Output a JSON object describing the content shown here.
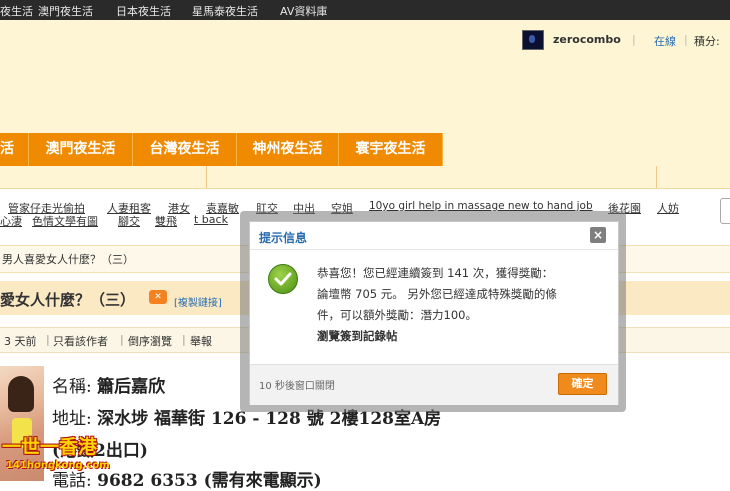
{
  "topnav": [
    "夜生活",
    "澳門夜生活",
    "日本夜生活",
    "星馬泰夜生活",
    "AV資料庫"
  ],
  "user": {
    "name": "zerocombo",
    "status": "在線",
    "credits_label": "積分:"
  },
  "main_nav": [
    "活",
    "澳門夜生活",
    "台灣夜生活",
    "神州夜生活",
    "寰宇夜生活"
  ],
  "tags_row1": [
    "管家仔走光偷拍",
    "人妻租客",
    "港女",
    "袁嘉敏",
    "肛交",
    "中出",
    "空姐",
    "10yo girl help in massage new to hand job",
    "後花園",
    "人妨"
  ],
  "tags_row2": [
    "心淒",
    "色情文學有圖",
    "腳交",
    "雙飛",
    "t back"
  ],
  "breadcrumb": "男人喜愛女人什麼？（三）",
  "thread": {
    "title": "愛女人什麼？（三）",
    "copy_link": "[複製鏈接]"
  },
  "postinfo": {
    "time": "3 天前",
    "only_author": "只看該作者",
    "reverse": "倒序瀏覽",
    "report": "舉報"
  },
  "post": {
    "name_label": "名稱:",
    "name_value": "簫后嘉欣",
    "addr_label": "地址:",
    "addr_value": "深水埗 福華街 126 - 128 號 2樓128室A房",
    "exit_value": "(港鐵2出口)",
    "phone_label": "電話:",
    "phone_value": "9682 6353 (需有來電顯示)"
  },
  "watermark": {
    "big": "一世一香港",
    "small": "141hongkong.com"
  },
  "dialog": {
    "title": "提示信息",
    "close": "×",
    "line1": "恭喜您！您已經連續簽到 141 次，獲得獎勵：",
    "line2": "論壇幣 705 元。 另外您已經達成特殊獎勵的條",
    "line3": "件，可以額外獎勵：潛力100。",
    "link": "瀏覽簽到記錄帖",
    "countdown": "10 秒後窗口關閉",
    "ok": "確定"
  },
  "colors": {
    "accent": "#f08a00",
    "header_bg": "#fdf5d4",
    "link": "#2b6cb0"
  }
}
